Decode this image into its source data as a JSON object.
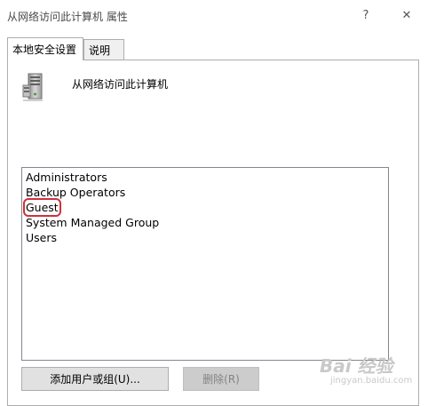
{
  "window": {
    "title": "从网络访问此计算机 属性",
    "help_glyph": "?",
    "close_glyph": "✕"
  },
  "tabs": [
    {
      "label": "本地安全设置",
      "active": true
    },
    {
      "label": "说明",
      "active": false
    }
  ],
  "policy": {
    "name": "从网络访问此计算机",
    "icon": "server-computer-icon"
  },
  "members": [
    {
      "label": "Administrators",
      "highlighted": false
    },
    {
      "label": "Backup Operators",
      "highlighted": false
    },
    {
      "label": "Guest",
      "highlighted": true
    },
    {
      "label": "System Managed Group",
      "highlighted": false
    },
    {
      "label": "Users",
      "highlighted": false
    }
  ],
  "buttons": {
    "add_label": "添加用户或组(U)...",
    "delete_label": "删除(R)"
  },
  "watermark": {
    "main": "Bai 经验",
    "sub": "jingyan.baidu.com"
  },
  "colors": {
    "highlight_outline": "#d0303a",
    "button_face": "#e1e1e1",
    "disabled_text": "#838383"
  }
}
